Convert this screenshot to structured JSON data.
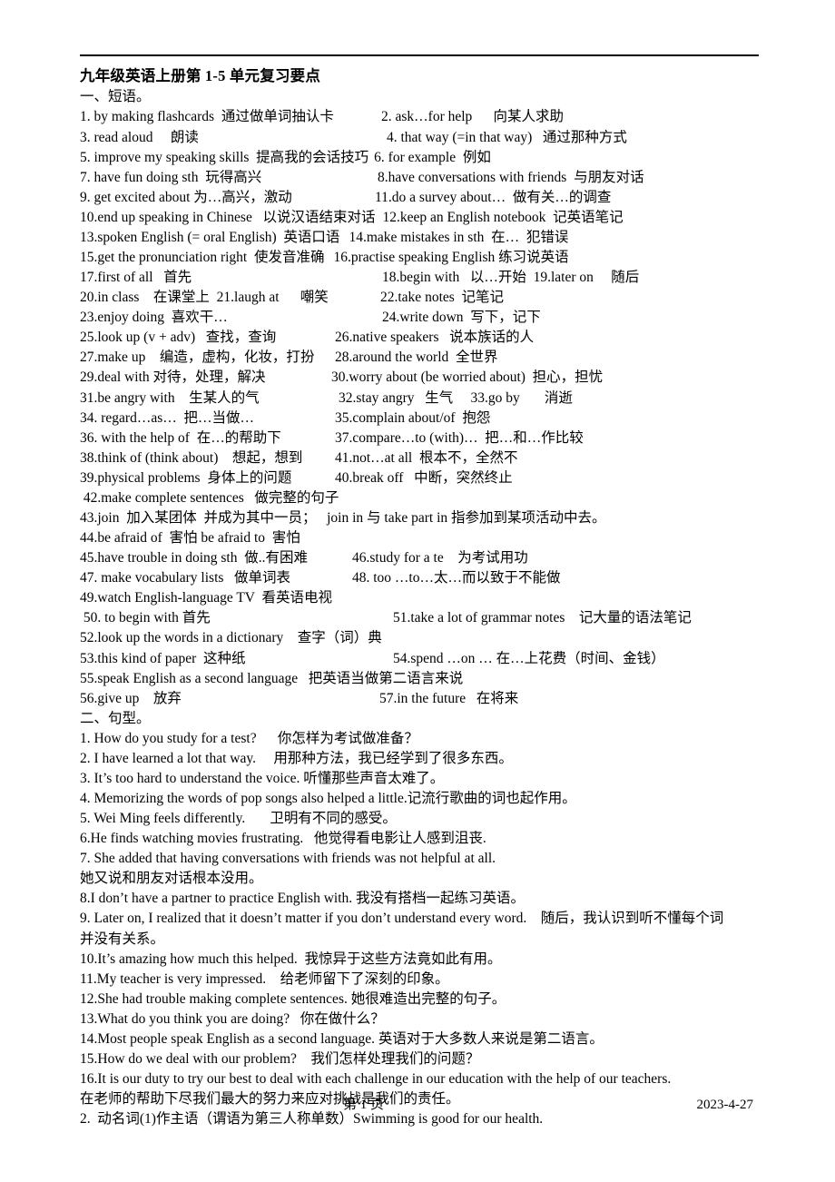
{
  "document": {
    "title": "九年级英语上册第 1-5 单元复习要点",
    "section_one_head": "一、短语。",
    "section_two_head": "二、句型。",
    "phrases": [
      {
        "left": "1. by making flashcards  通过做单词抽认卡",
        "right": "2. ask…for help      向某人求助"
      },
      {
        "left": "3. read aloud     朗读",
        "right": "4. that way (=in that way)   通过那种方式"
      },
      {
        "left": "5. improve my speaking skills  提高我的会话技巧",
        "right": "6. for example  例如"
      },
      {
        "left": "7. have fun doing sth  玩得高兴",
        "right": "8.have conversations with friends  与朋友对话"
      },
      {
        "left": "9. get excited about 为…高兴，激动",
        "right": "11.do a survey about…  做有关…的调查"
      },
      {
        "left": "10.end up speaking in Chinese   以说汉语结束对话",
        "right": "12.keep an English notebook  记英语笔记"
      },
      {
        "left": "13.spoken English (= oral English)  英语口语",
        "right": "14.make mistakes in sth  在…  犯错误"
      },
      {
        "left": "15.get the pronunciation right  使发音准确",
        "right": "16.practise speaking English 练习说英语"
      },
      {
        "left": "17.first of all   首先",
        "right": "18.begin with   以…开始  19.later on     随后"
      },
      {
        "left": "20.in class    在课堂上  21.laugh at      嘲笑",
        "right": "22.take notes  记笔记"
      },
      {
        "left": "23.enjoy doing  喜欢干…",
        "right": "24.write down  写下，记下"
      },
      {
        "left": "25.look up (v + adv)   查找，查询",
        "right": "26.native speakers   说本族话的人"
      },
      {
        "left": "27.make up    编造，虚构，化妆，打扮",
        "right": "28.around the world  全世界"
      },
      {
        "left": "29.deal with 对待，处理，解决",
        "right": "30.worry about (be worried about)  担心，担忧"
      },
      {
        "left": "31.be angry with    生某人的气",
        "right": "32.stay angry   生气     33.go by       消逝"
      },
      {
        "left": "34. regard…as…  把…当做…",
        "right": "35.complain about/of  抱怨"
      },
      {
        "left": "36. with the help of  在…的帮助下",
        "right": "37.compare…to (with)…  把…和…作比较"
      },
      {
        "left": "38.think of (think about)    想起，想到",
        "right": "41.not…at all  根本不，全然不"
      },
      {
        "left": "39.physical problems  身体上的问题",
        "right": "40.break off   中断，突然终止"
      }
    ],
    "phrases_full": [
      " 42.make complete sentences   做完整的句子",
      "43.join  加入某团体  并成为其中一员；   join in 与 take part in 指参加到某项活动中去。",
      "44.be afraid of  害怕 be afraid to  害怕"
    ],
    "phrases2": [
      {
        "left": "45.have trouble in doing sth  做..有困难",
        "right": "46.study for a te    为考试用功"
      },
      {
        "left": "47. make vocabulary lists   做单词表",
        "right": "48. too …to…太…而以致于不能做"
      }
    ],
    "phrases2_full": [
      "49.watch English-language TV  看英语电视"
    ],
    "phrases3": [
      {
        "left": " 50. to begin with 首先",
        "right": "51.take a lot of grammar notes    记大量的语法笔记"
      }
    ],
    "phrases3_full": [
      "52.look up the words in a dictionary    查字（词）典"
    ],
    "phrases4": [
      {
        "left": "53.this kind of paper  这种纸",
        "right": "54.spend …on … 在…上花费（时间、金钱）"
      }
    ],
    "phrases4_full": [
      "55.speak English as a second language   把英语当做第二语言来说"
    ],
    "phrases5": [
      {
        "left": "56.give up    放弃",
        "right": "57.in the future   在将来"
      }
    ],
    "sentences": [
      "1. How do you study for a test?      你怎样为考试做准备？",
      "2. I have learned a lot that way.     用那种方法，我已经学到了很多东西。",
      "3. It’s too hard to understand the voice. 听懂那些声音太难了。",
      "4. Memorizing the words of pop songs also helped a little.记流行歌曲的词也起作用。",
      "5. Wei Ming feels differently.       卫明有不同的感受。",
      "6.He finds watching movies frustrating.   他觉得看电影让人感到沮丧.",
      "7. She added that having conversations with friends was not helpful at all.",
      "她又说和朋友对话根本没用。",
      "8.I don’t have a partner to practice English with. 我没有搭档一起练习英语。",
      "9. Later on, I realized that it doesn’t matter if you don’t understand every word.    随后，我认识到听不懂每个词",
      "并没有关系。",
      "10.It’s amazing how much this helped.  我惊异于这些方法竟如此有用。",
      "11.My teacher is very impressed.    给老师留下了深刻的印象。",
      "12.She had trouble making complete sentences. 她很难造出完整的句子。",
      "13.What do you think you are doing?   你在做什么？",
      "14.Most people speak English as a second language. 英语对于大多数人来说是第二语言。",
      "15.How do we deal with our problem?    我们怎样处理我们的问题？",
      "16.It is our duty to try our best to deal with each challenge in our education with the help of our teachers.",
      "在老师的帮助下尽我们最大的努力来应对挑战是我们的责任。",
      "2.  动名词(1)作主语（谓语为第三人称单数）Swimming is good for our health."
    ]
  },
  "footer": {
    "page_label": "第 1 页",
    "date": "2023-4-27"
  }
}
